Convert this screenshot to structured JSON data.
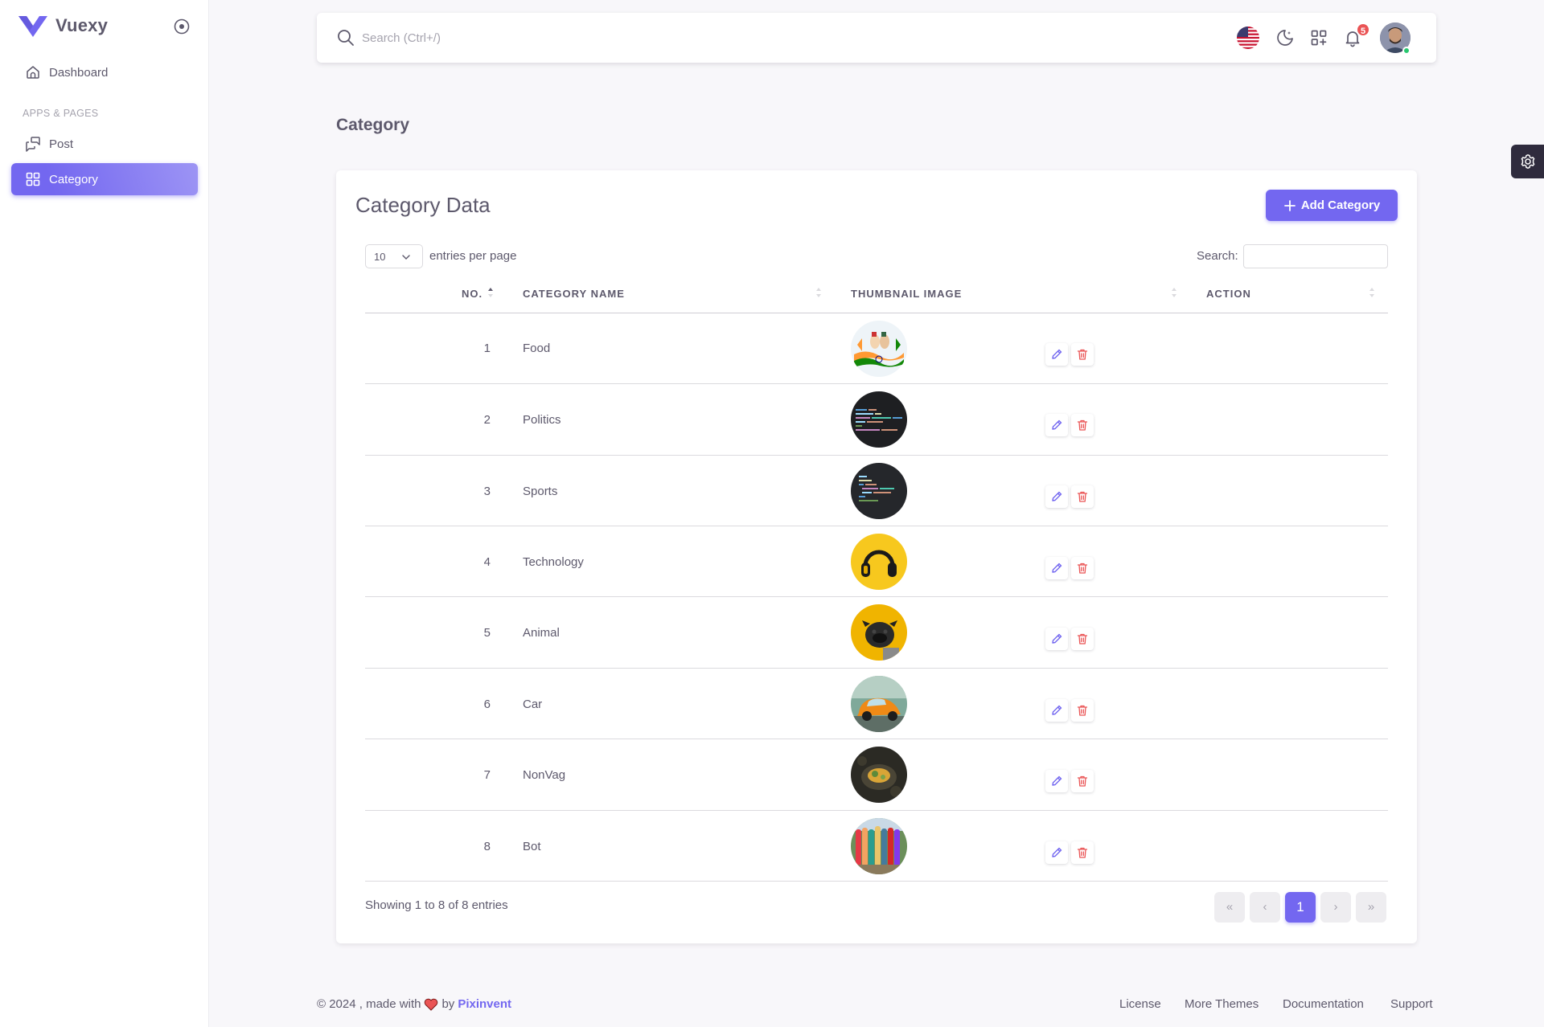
{
  "brand": {
    "name": "Vuexy"
  },
  "sidebar": {
    "items": [
      {
        "label": "Dashboard",
        "icon": "home-icon"
      },
      {
        "label": "Post",
        "icon": "messages-icon"
      },
      {
        "label": "Category",
        "icon": "grid-icon",
        "active": true
      }
    ],
    "section_header": "APPS & PAGES"
  },
  "navbar": {
    "search_placeholder": "Search (Ctrl+/)",
    "notification_count": "5",
    "icons": [
      "us-flag-icon",
      "moon-icon",
      "apps-icon",
      "bell-icon",
      "avatar"
    ]
  },
  "page": {
    "title": "Category"
  },
  "card": {
    "title": "Category Data",
    "add_button": "Add Category",
    "length_value": "10",
    "length_label": "entries per page",
    "search_label": "Search:",
    "columns": [
      "NO.",
      "CATEGORY NAME",
      "THUMBNAIL IMAGE",
      "ACTION"
    ],
    "rows": [
      {
        "no": "1",
        "name": "Food",
        "thumb": "indian-flag-art"
      },
      {
        "no": "2",
        "name": "Politics",
        "thumb": "code-dark"
      },
      {
        "no": "3",
        "name": "Sports",
        "thumb": "code-dark"
      },
      {
        "no": "4",
        "name": "Technology",
        "thumb": "headphones-yellow"
      },
      {
        "no": "5",
        "name": "Animal",
        "thumb": "pug-yellow"
      },
      {
        "no": "6",
        "name": "Car",
        "thumb": "orange-beetle"
      },
      {
        "no": "7",
        "name": "NonVag",
        "thumb": "food-dark"
      },
      {
        "no": "8",
        "name": "Bot",
        "thumb": "colorful-surfboards"
      }
    ],
    "info": "Showing 1 to 8 of 8 entries",
    "pagination": {
      "first": "«",
      "prev": "‹",
      "current": "1",
      "next": "›",
      "last": "»"
    }
  },
  "footer": {
    "copyright": "© 2024 , made with",
    "by": "by",
    "brand_link": "Pixinvent",
    "links": [
      "License",
      "More Themes",
      "Documentation",
      "Support"
    ]
  },
  "colors": {
    "primary": "#7367f0",
    "danger": "#ea5455",
    "success": "#28c76f"
  }
}
